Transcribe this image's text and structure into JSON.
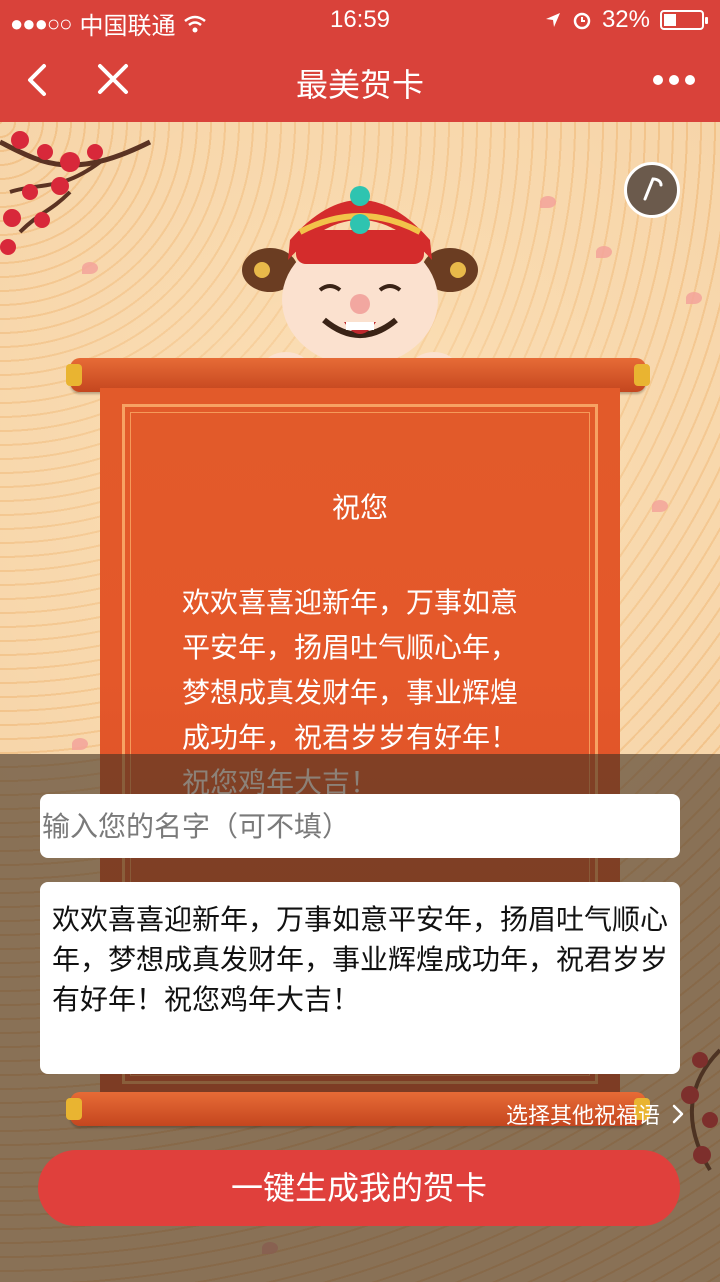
{
  "status_bar": {
    "signal": "●●●○○",
    "carrier": "中国联通",
    "time": "16:59",
    "battery_percent": "32%",
    "battery_level": 0.32
  },
  "nav": {
    "title": "最美贺卡",
    "back_icon": "chevron-left-icon",
    "close_icon": "close-icon",
    "more_icon": "more-icon"
  },
  "card": {
    "heading": "祝您",
    "message": "欢欢喜喜迎新年，万事如意平安年，扬眉吐气顺心年，梦想成真发财年，事业辉煌成功年，祝君岁岁有好年！祝您鸡年大吉！"
  },
  "form": {
    "name_placeholder": "输入您的名字（可不填）",
    "message_value": "欢欢喜喜迎新年，万事如意平安年，扬眉吐气顺心年，梦想成真发财年，事业辉煌成功年，祝君岁岁有好年！祝您鸡年大吉！",
    "choose_other_label": "选择其他祝福语",
    "generate_button_label": "一键生成我的贺卡"
  },
  "colors": {
    "accent_red": "#d9423a",
    "scroll_orange": "#e25a2a",
    "background_tan": "#f3c691"
  }
}
